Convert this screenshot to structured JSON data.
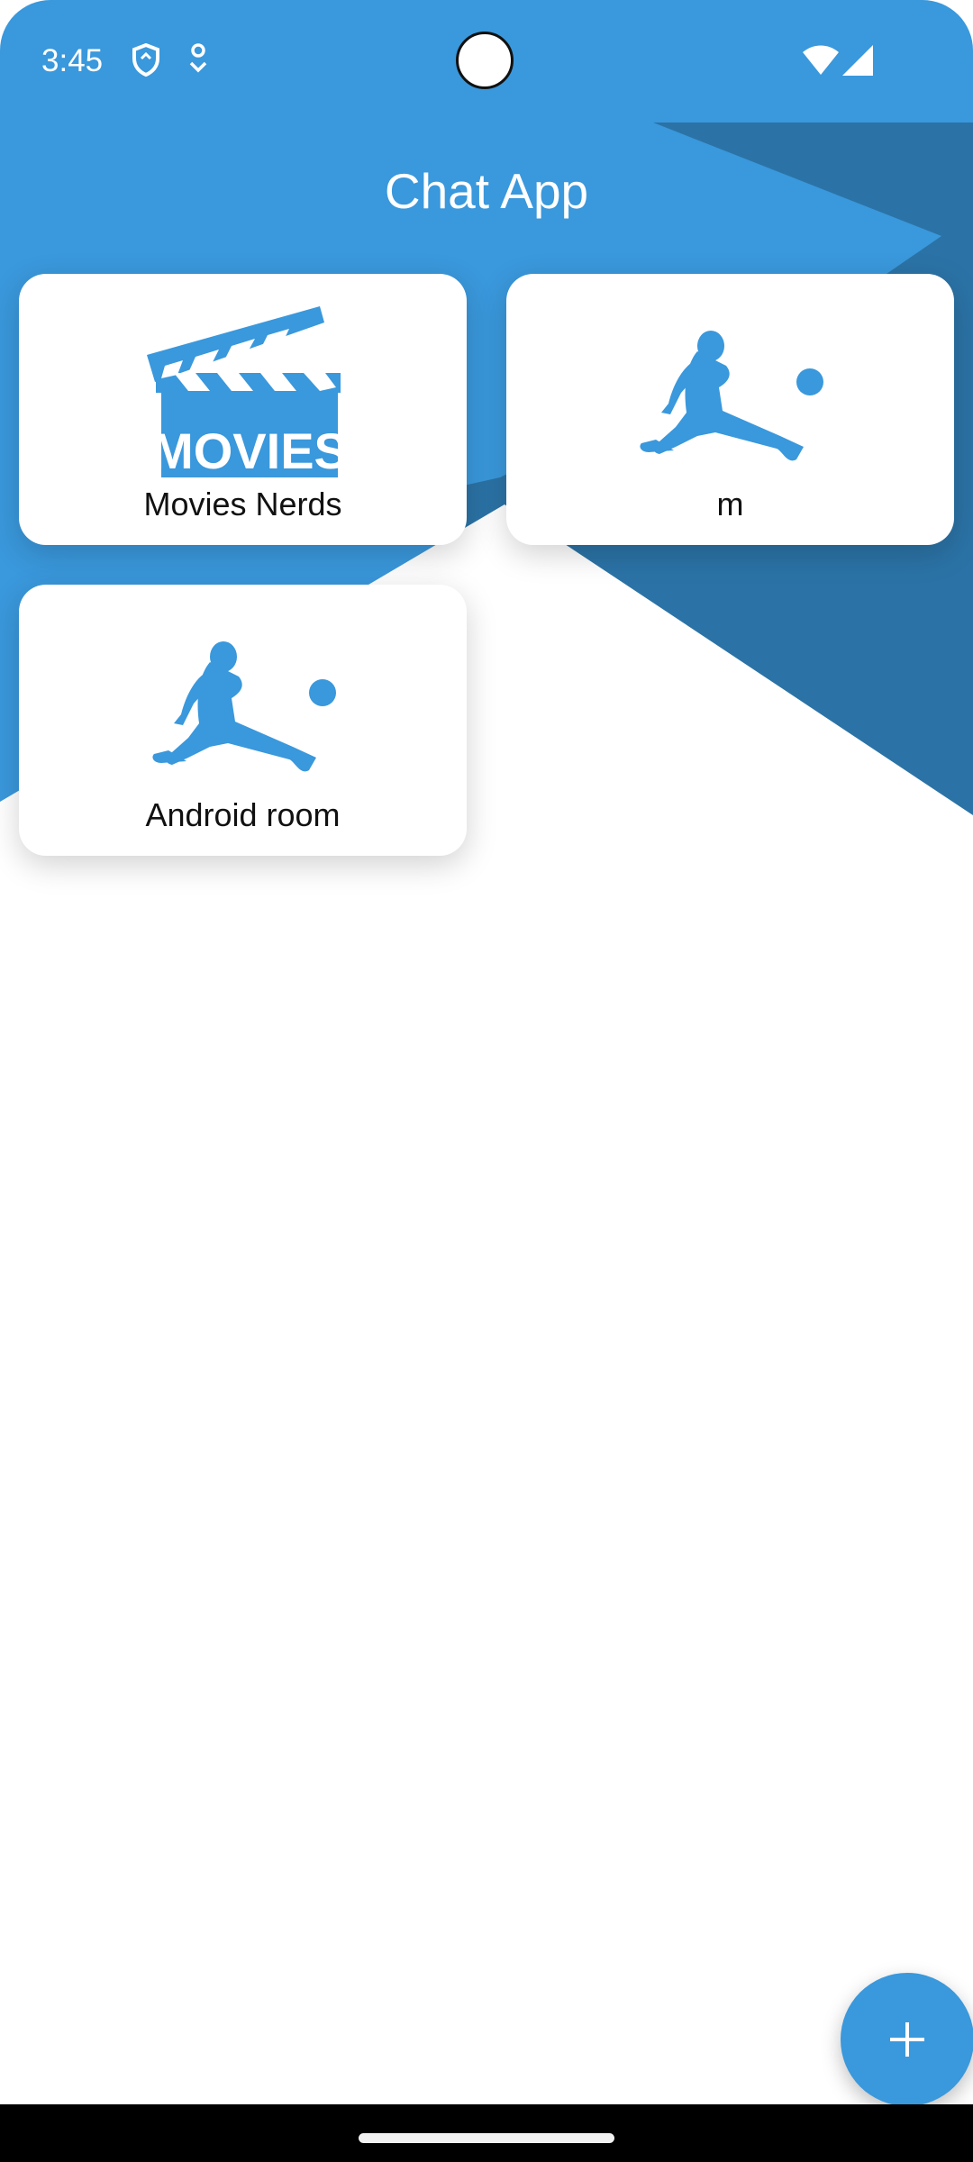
{
  "status_bar": {
    "time": "3:45",
    "icons": [
      "shield-icon",
      "location-pin-icon",
      "wifi-icon",
      "signal-icon"
    ]
  },
  "app_bar": {
    "title": "Chat App"
  },
  "rooms": [
    {
      "name": "Movies Nerds",
      "icon": "movies-clapperboard-icon",
      "icon_text": "MOVIES"
    },
    {
      "name": "m",
      "icon": "soccer-player-icon"
    },
    {
      "name": "Android room",
      "icon": "soccer-player-icon"
    }
  ],
  "fab": {
    "icon": "plus-icon"
  },
  "colors": {
    "primary": "#3a98dc",
    "primary_dark": "#2b73a6",
    "card_background": "#ffffff",
    "title_text": "#ffffff",
    "card_text": "#111111"
  }
}
